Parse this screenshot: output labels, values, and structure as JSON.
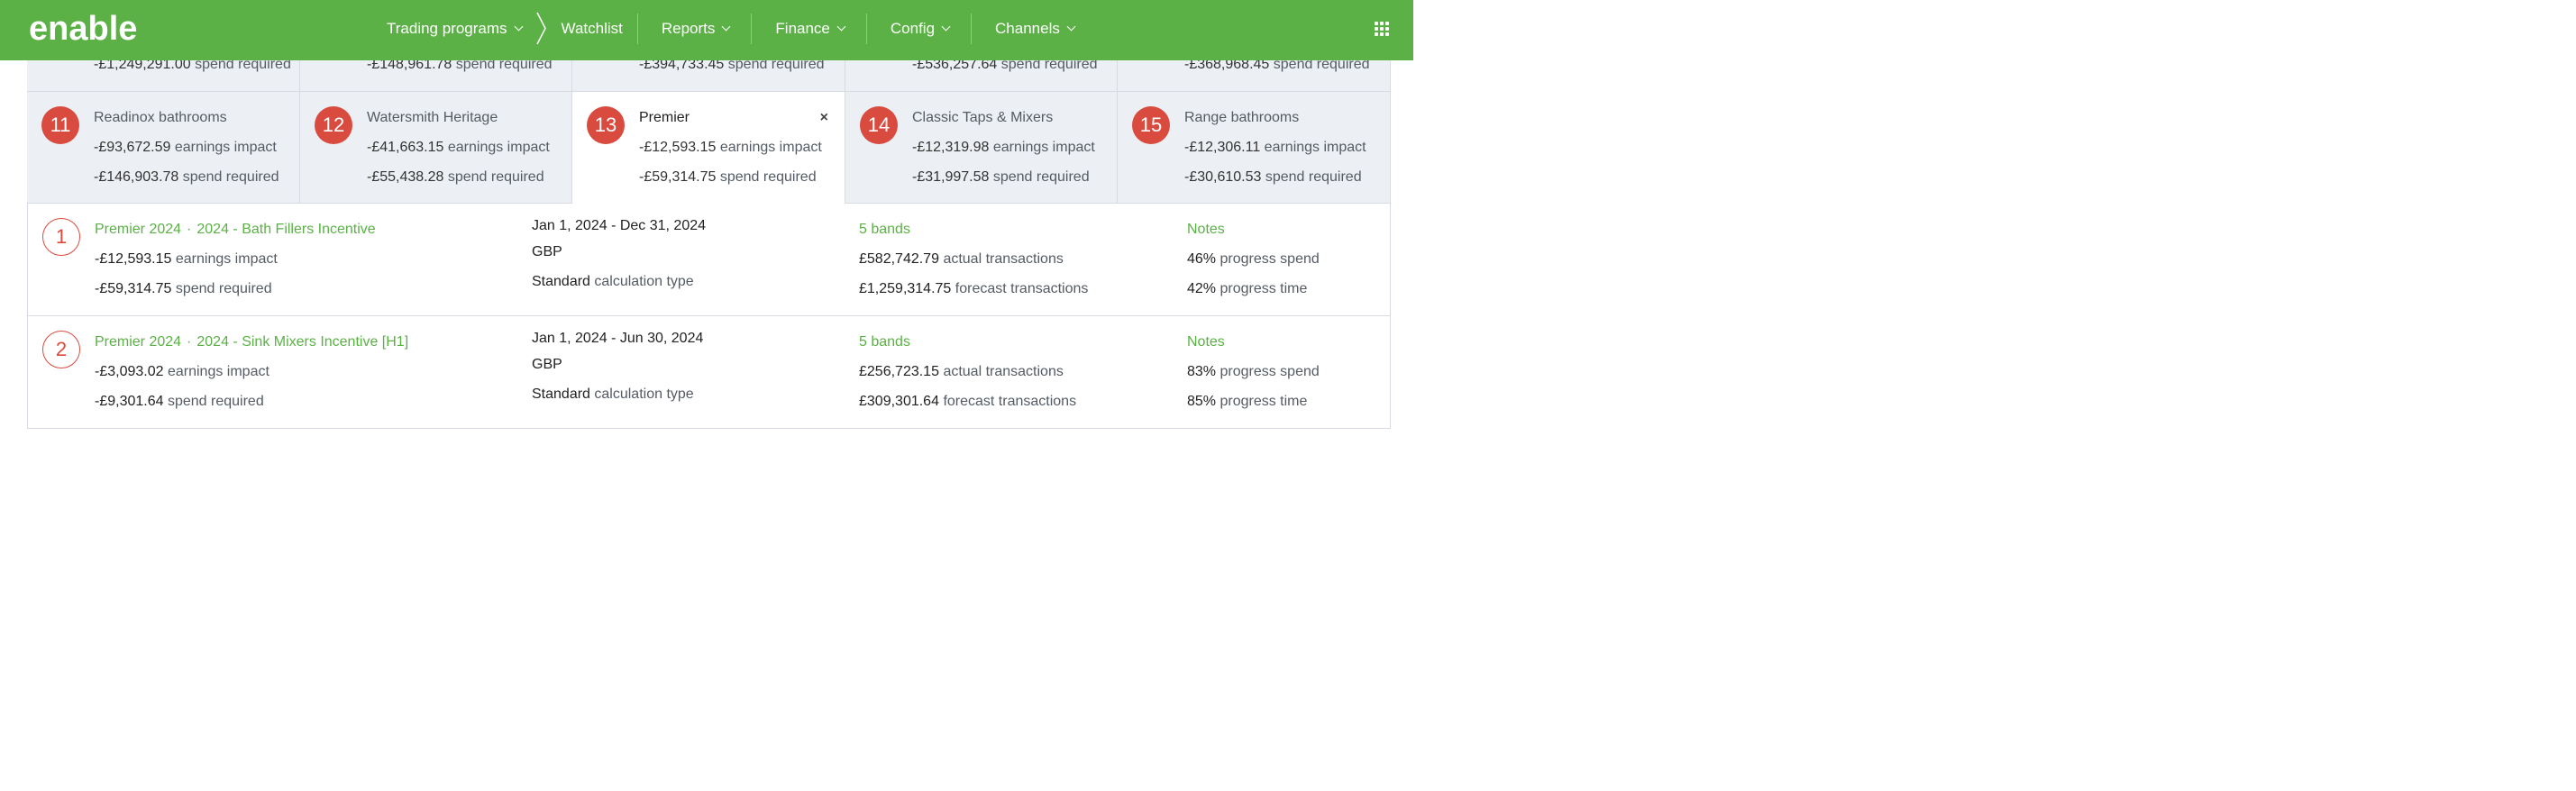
{
  "app": {
    "brand": "enable",
    "nav": [
      {
        "label": "Trading programs",
        "has_dropdown": true
      },
      {
        "label": "Watchlist",
        "has_dropdown": false
      },
      {
        "label": "Reports",
        "has_dropdown": true
      },
      {
        "label": "Finance",
        "has_dropdown": true
      },
      {
        "label": "Config",
        "has_dropdown": true
      },
      {
        "label": "Channels",
        "has_dropdown": true
      }
    ],
    "accent_color": "#5bb146",
    "badge_color": "#d84b3e"
  },
  "top_partial_cards": [
    {
      "value": "-£1,249,291.00",
      "suffix": "spend required"
    },
    {
      "value": "-£148,961.78",
      "suffix": "spend required"
    },
    {
      "value": "-£394,733.45",
      "suffix": "spend required"
    },
    {
      "value": "-£536,257.64",
      "suffix": "spend required"
    },
    {
      "value": "-£368,968.45",
      "suffix": "spend required"
    }
  ],
  "cards": [
    {
      "rank": "11",
      "name": "Readinox bathrooms",
      "earnings": "-£93,672.59",
      "earnings_label": "earnings impact",
      "spend": "-£146,903.78",
      "spend_label": "spend required"
    },
    {
      "rank": "12",
      "name": "Watersmith Heritage",
      "earnings": "-£41,663.15",
      "earnings_label": "earnings impact",
      "spend": "-£55,438.28",
      "spend_label": "spend required"
    },
    {
      "rank": "13",
      "name": "Premier",
      "earnings": "-£12,593.15",
      "earnings_label": "earnings impact",
      "spend": "-£59,314.75",
      "spend_label": "spend required",
      "close": "×"
    },
    {
      "rank": "14",
      "name": "Classic Taps & Mixers",
      "earnings": "-£12,319.98",
      "earnings_label": "earnings impact",
      "spend": "-£31,997.58",
      "spend_label": "spend required"
    },
    {
      "rank": "15",
      "name": "Range bathrooms",
      "earnings": "-£12,306.11",
      "earnings_label": "earnings impact",
      "spend": "-£30,610.53",
      "spend_label": "spend required"
    }
  ],
  "programs": [
    {
      "index": "1",
      "program": "Premier 2024",
      "separator": "·",
      "incentive": "2024 - Bath Fillers Incentive",
      "earnings": "-£12,593.15",
      "earnings_label": "earnings impact",
      "spend": "-£59,314.75",
      "spend_label": "spend required",
      "dates": "Jan 1, 2024 - Dec 31, 2024",
      "currency": "GBP",
      "calc_type": "Standard",
      "calc_label": "calculation type",
      "bands": "5 bands",
      "actual": "£582,742.79",
      "actual_label": "actual transactions",
      "forecast": "£1,259,314.75",
      "forecast_label": "forecast transactions",
      "notes": "Notes",
      "progress_spend": "46%",
      "progress_spend_label": "progress spend",
      "progress_time": "42%",
      "progress_time_label": "progress time"
    },
    {
      "index": "2",
      "program": "Premier 2024",
      "separator": "·",
      "incentive": "2024 - Sink Mixers Incentive [H1]",
      "earnings": "-£3,093.02",
      "earnings_label": "earnings impact",
      "spend": "-£9,301.64",
      "spend_label": "spend required",
      "dates": "Jan 1, 2024 - Jun 30, 2024",
      "currency": "GBP",
      "calc_type": "Standard",
      "calc_label": "calculation type",
      "bands": "5 bands",
      "actual": "£256,723.15",
      "actual_label": "actual transactions",
      "forecast": "£309,301.64",
      "forecast_label": "forecast transactions",
      "notes": "Notes",
      "progress_spend": "83%",
      "progress_spend_label": "progress spend",
      "progress_time": "85%",
      "progress_time_label": "progress time"
    }
  ]
}
